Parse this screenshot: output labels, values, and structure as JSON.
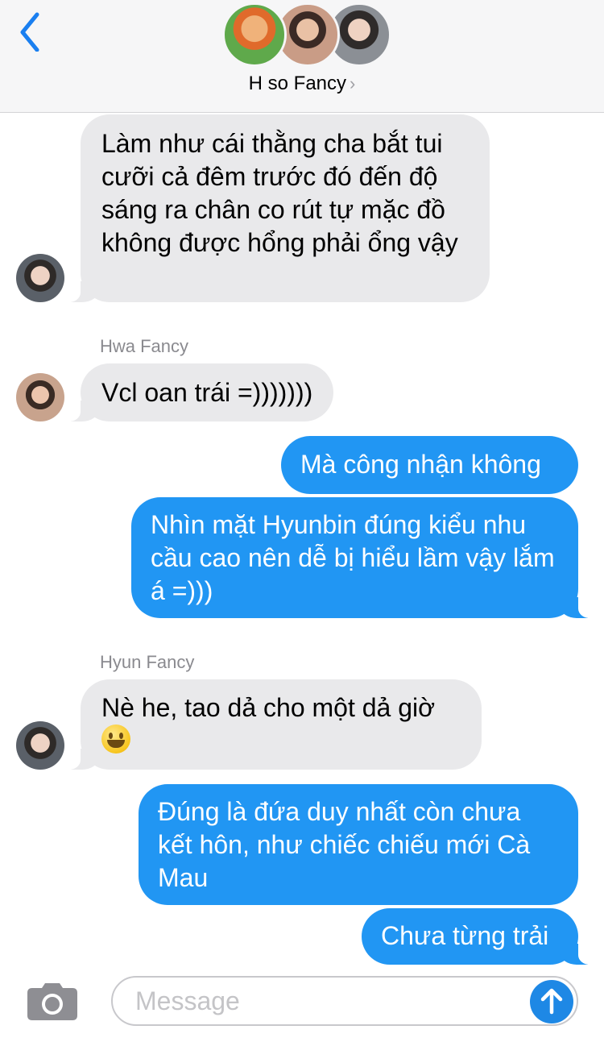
{
  "header": {
    "group_name": "H so Fancy",
    "chevron": "›",
    "back_icon": "chevron-left-icon"
  },
  "messages": [
    {
      "direction": "incoming",
      "sender": "",
      "text": "Làm như cái thằng cha bắt tui cưỡi cả đêm trước đó đến độ sáng ra chân co rút tự mặc đồ không được hổng phải ổng vậy"
    },
    {
      "direction": "incoming",
      "sender": "Hwa Fancy",
      "text": "Vcl oan trái =)))))))"
    },
    {
      "direction": "outgoing",
      "text": "Mà công nhận không"
    },
    {
      "direction": "outgoing",
      "text": "Nhìn mặt Hyunbin đúng kiểu nhu cầu cao nên dễ bị hiểu lầm vậy lắm á =)))"
    },
    {
      "direction": "incoming",
      "sender": "Hyun Fancy",
      "text": "Nè he, tao dả cho một dả giờ",
      "emoji": "grinning-face"
    },
    {
      "direction": "outgoing",
      "text": "Đúng là đứa duy nhất còn chưa kết hôn, như chiếc chiếu mới Cà Mau"
    },
    {
      "direction": "outgoing",
      "text": "Chưa từng trải"
    }
  ],
  "input": {
    "placeholder": "Message",
    "camera_icon": "camera-icon",
    "send_icon": "arrow-up-icon"
  },
  "colors": {
    "outgoing_bubble": "#2196f3",
    "incoming_bubble": "#e9e9eb",
    "accent": "#1e88e5"
  }
}
